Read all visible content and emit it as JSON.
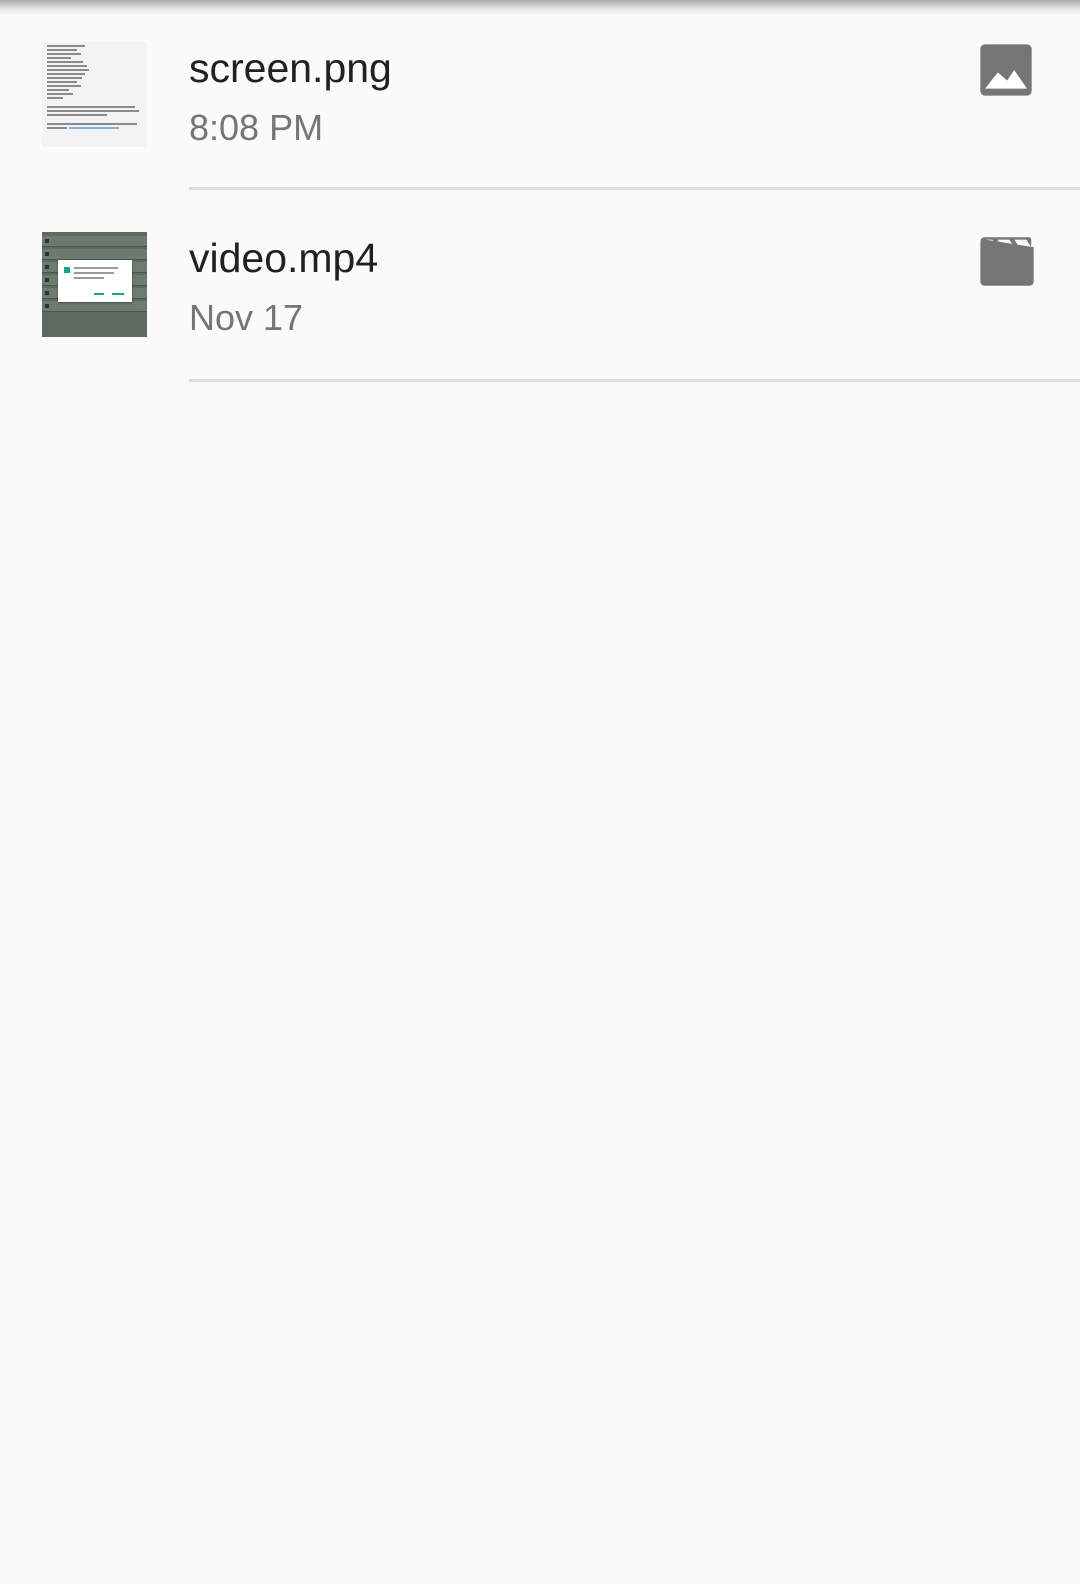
{
  "files": [
    {
      "name": "screen.png",
      "date": "8:08 PM",
      "type_icon": "image-icon",
      "thumbnail": "document-screenshot-thumbnail"
    },
    {
      "name": "video.mp4",
      "date": "Nov 17",
      "type_icon": "movie-clapper-icon",
      "thumbnail": "video-frame-thumbnail"
    }
  ],
  "colors": {
    "background": "#fafafa",
    "primary_text": "#212121",
    "secondary_text": "#757575",
    "icon": "#757575",
    "divider": "#dcdcdc"
  }
}
